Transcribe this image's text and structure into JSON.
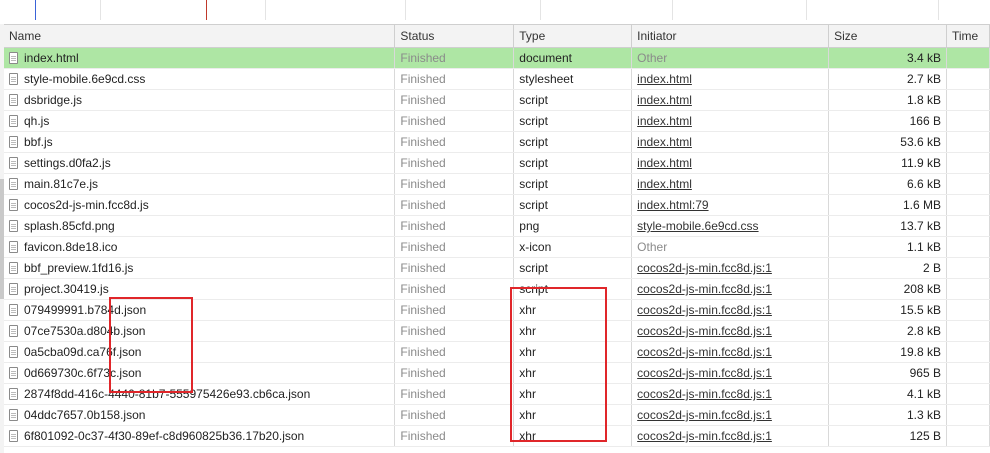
{
  "columns": {
    "name": "Name",
    "status": "Status",
    "type": "Type",
    "initiator": "Initiator",
    "size": "Size",
    "time": "Time"
  },
  "rows": [
    {
      "name": "index.html",
      "status": "Finished",
      "type": "document",
      "initiator": "Other",
      "initiator_link": false,
      "size": "3.4 kB",
      "selected": true
    },
    {
      "name": "style-mobile.6e9cd.css",
      "status": "Finished",
      "type": "stylesheet",
      "initiator": "index.html",
      "initiator_link": true,
      "size": "2.7 kB"
    },
    {
      "name": "dsbridge.js",
      "status": "Finished",
      "type": "script",
      "initiator": "index.html",
      "initiator_link": true,
      "size": "1.8 kB"
    },
    {
      "name": "qh.js",
      "status": "Finished",
      "type": "script",
      "initiator": "index.html",
      "initiator_link": true,
      "size": "166 B"
    },
    {
      "name": "bbf.js",
      "status": "Finished",
      "type": "script",
      "initiator": "index.html",
      "initiator_link": true,
      "size": "53.6 kB"
    },
    {
      "name": "settings.d0fa2.js",
      "status": "Finished",
      "type": "script",
      "initiator": "index.html",
      "initiator_link": true,
      "size": "11.9 kB"
    },
    {
      "name": "main.81c7e.js",
      "status": "Finished",
      "type": "script",
      "initiator": "index.html",
      "initiator_link": true,
      "size": "6.6 kB"
    },
    {
      "name": "cocos2d-js-min.fcc8d.js",
      "status": "Finished",
      "type": "script",
      "initiator": "index.html:79",
      "initiator_link": true,
      "size": "1.6 MB"
    },
    {
      "name": "splash.85cfd.png",
      "status": "Finished",
      "type": "png",
      "initiator": "style-mobile.6e9cd.css",
      "initiator_link": true,
      "size": "13.7 kB"
    },
    {
      "name": "favicon.8de18.ico",
      "status": "Finished",
      "type": "x-icon",
      "initiator": "Other",
      "initiator_link": false,
      "size": "1.1 kB"
    },
    {
      "name": "bbf_preview.1fd16.js",
      "status": "Finished",
      "type": "script",
      "initiator": "cocos2d-js-min.fcc8d.js:1",
      "initiator_link": true,
      "size": "2 B"
    },
    {
      "name": "project.30419.js",
      "status": "Finished",
      "type": "script",
      "initiator": "cocos2d-js-min.fcc8d.js:1",
      "initiator_link": true,
      "size": "208 kB"
    },
    {
      "name": "079499991.b784d.json",
      "status": "Finished",
      "type": "xhr",
      "initiator": "cocos2d-js-min.fcc8d.js:1",
      "initiator_link": true,
      "size": "15.5 kB"
    },
    {
      "name": "07ce7530a.d804b.json",
      "status": "Finished",
      "type": "xhr",
      "initiator": "cocos2d-js-min.fcc8d.js:1",
      "initiator_link": true,
      "size": "2.8 kB"
    },
    {
      "name": "0a5cba09d.ca76f.json",
      "status": "Finished",
      "type": "xhr",
      "initiator": "cocos2d-js-min.fcc8d.js:1",
      "initiator_link": true,
      "size": "19.8 kB"
    },
    {
      "name": "0d669730c.6f73c.json",
      "status": "Finished",
      "type": "xhr",
      "initiator": "cocos2d-js-min.fcc8d.js:1",
      "initiator_link": true,
      "size": "965 B"
    },
    {
      "name": "2874f8dd-416c-4440-81b7-555975426e93.cb6ca.json",
      "status": "Finished",
      "type": "xhr",
      "initiator": "cocos2d-js-min.fcc8d.js:1",
      "initiator_link": true,
      "size": "4.1 kB"
    },
    {
      "name": "04ddc7657.0b158.json",
      "status": "Finished",
      "type": "xhr",
      "initiator": "cocos2d-js-min.fcc8d.js:1",
      "initiator_link": true,
      "size": "1.3 kB"
    },
    {
      "name": "6f801092-0c37-4f30-89ef-c8d960825b36.17b20.json",
      "status": "Finished",
      "type": "xhr",
      "initiator": "cocos2d-js-min.fcc8d.js:1",
      "initiator_link": true,
      "size": "125 B"
    }
  ],
  "colors": {
    "selected_row": "#aee6a4",
    "highlight_box": "#e0262a",
    "timeline_blue": "#3a63d8",
    "timeline_red": "#c0392b"
  }
}
